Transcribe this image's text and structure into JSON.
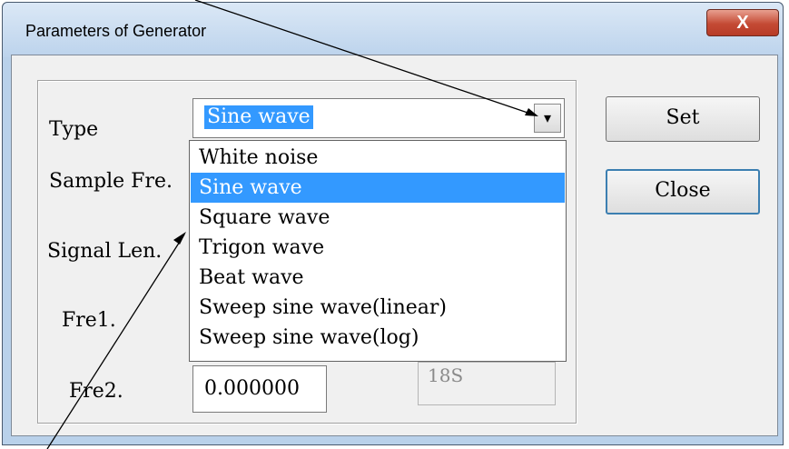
{
  "window": {
    "title": "Parameters of Generator",
    "close_glyph": "X"
  },
  "form": {
    "type_label": "Type",
    "sample_label": "Sample Fre.",
    "signal_label": "Signal Len.",
    "fre1_label": "Fre1.",
    "fre2_label": "Fre2.",
    "fre2_value": "0.000000",
    "secondary_value": "18S"
  },
  "combo": {
    "value": "Sine wave",
    "arrow_glyph": "▾",
    "options": [
      "White noise",
      "Sine wave",
      "Square wave",
      "Trigon wave",
      "Beat wave",
      "Sweep sine wave(linear)",
      "Sweep sine wave(log)"
    ],
    "selected_index": 1
  },
  "buttons": {
    "set_label": "Set",
    "close_label": "Close"
  },
  "colors": {
    "selection": "#3399ff",
    "close_button": "#c44a34",
    "title_bar": "#bcd3ec"
  }
}
